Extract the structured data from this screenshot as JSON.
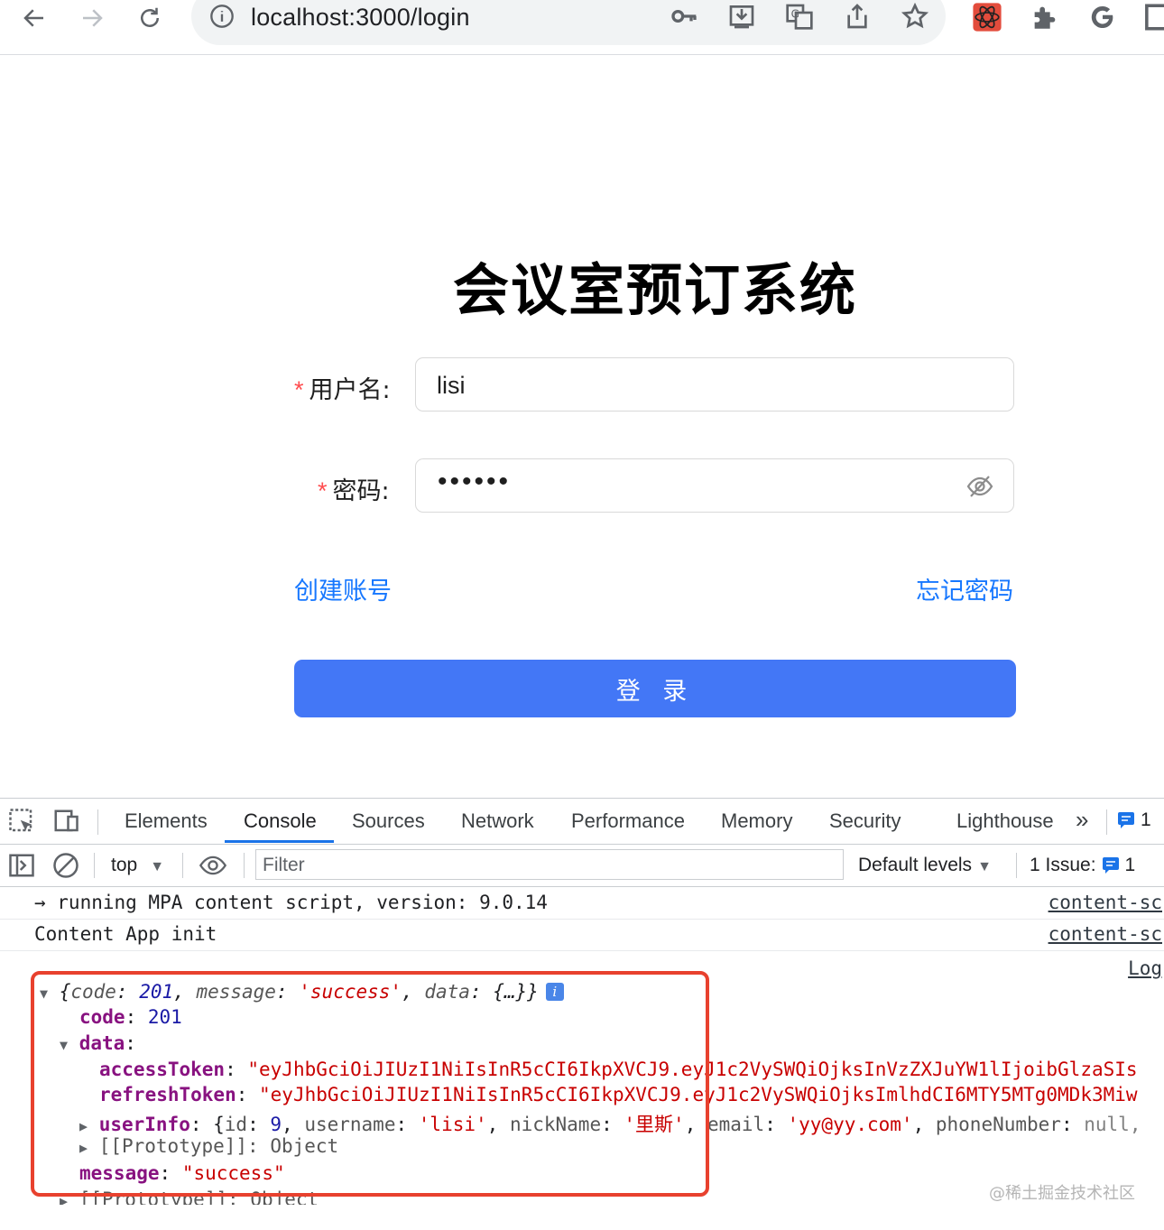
{
  "browser": {
    "url": "localhost:3000/login"
  },
  "page": {
    "title": "会议室预订系统",
    "username_label": "用户名:",
    "password_label": "密码:",
    "required_mark": "*",
    "username_value": "lisi",
    "password_mask": "••••••",
    "create_account": "创建账号",
    "forgot_password": "忘记密码",
    "login_button": "登 录",
    "accent_color": "#4377f6",
    "link_color": "#1677ff"
  },
  "devtools": {
    "tabs": [
      "Elements",
      "Console",
      "Sources",
      "Network",
      "Performance",
      "Memory",
      "Security",
      "Lighthouse"
    ],
    "active_tab": "Console",
    "more_tabs": "»",
    "messages_count": "1",
    "context": "top",
    "filter_placeholder": "Filter",
    "levels": "Default levels",
    "issues_label": "1 Issue:",
    "issues_count": "1",
    "logs": [
      {
        "text": "→ running MPA content script, version: 9.0.14",
        "source": "content-sc"
      },
      {
        "text": "Content App init",
        "source": "content-sc"
      }
    ],
    "object_log": {
      "source": "Log",
      "summary_code_key": "code",
      "summary_code_val": "201",
      "summary_message_key": "message",
      "summary_message_val": "'success'",
      "summary_data_key": "data",
      "summary_data_val": "{…}}",
      "code_key": "code",
      "code_val": "201",
      "data_key": "data",
      "access_key": "accessToken",
      "access_val": "\"eyJhbGciOiJIUzI1NiIsInR5cCI6IkpXVCJ9.eyJ1c2VySWQiOjksInVzZXJuYW1lIjoibGlzaSIs",
      "refresh_key": "refreshToken",
      "refresh_val": "\"eyJhbGciOiJIUzI1NiIsInR5cCI6IkpXVCJ9.eyJ1c2VySWQiOjksImlhdCI6MTY5MTg0MDk3Miw",
      "userinfo_key": "userInfo",
      "userinfo_id_key": "id",
      "userinfo_id_val": "9",
      "userinfo_username_key": "username",
      "userinfo_username_val": "'lisi'",
      "userinfo_nick_key": "nickName",
      "userinfo_nick_val": "'里斯'",
      "userinfo_email_key": "email",
      "userinfo_email_val": "'yy@yy.com'",
      "userinfo_phone_key": "phoneNumber",
      "userinfo_phone_val": "null,",
      "prototype_inner": "[[Prototype]]: Object",
      "message_key": "message",
      "message_val": "\"success\"",
      "prototype_outer": "[[Prototype]]: Object"
    },
    "watermark": "@稀土掘金技术社区",
    "highlight_color": "#e8412e"
  }
}
